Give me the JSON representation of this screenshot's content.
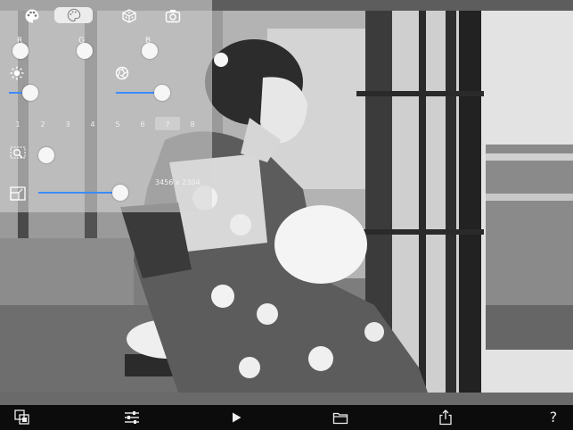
{
  "panel": {
    "rgb_labels": [
      "R",
      "G",
      "B"
    ],
    "filter_numbers": [
      "1",
      "2",
      "3",
      "4",
      "5",
      "6",
      "7",
      "8"
    ],
    "selected_filter": "7",
    "image_dimensions": "3456 x 2304",
    "sliders": {
      "brightness": 0.5,
      "contrast": 0.5,
      "size": 0.85
    },
    "accent_color": "#3d8bff",
    "icons": [
      "palette-icon",
      "palette-outline-icon",
      "dice-icon",
      "camera-compare-icon",
      "brightness-icon",
      "aperture-icon",
      "zoom-region-icon",
      "resize-icon"
    ]
  },
  "toolbar": {
    "icons": [
      "layers-icon",
      "sliders-icon",
      "play-icon",
      "folder-icon",
      "share-icon",
      "help-icon"
    ],
    "help_label": "?"
  }
}
